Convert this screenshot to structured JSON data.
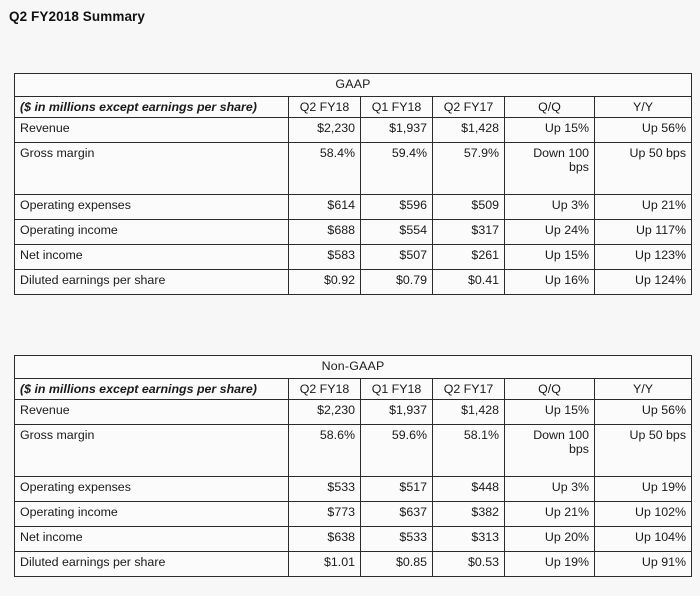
{
  "page": {
    "title": "Q2 FY2018 Summary",
    "background_color": "#f7f7f7",
    "text_color": "#1a1a1a",
    "border_color": "#2b2b2b"
  },
  "tables": [
    {
      "section_title": "GAAP",
      "label_header": "($ in millions except earnings per share)",
      "columns": [
        "Q2 FY18",
        "Q1 FY18",
        "Q2 FY17",
        "Q/Q",
        "Y/Y"
      ],
      "rows": [
        {
          "label": "Revenue",
          "values": [
            "$2,230",
            "$1,937",
            "$1,428",
            "Up 15%",
            "Up 56%"
          ]
        },
        {
          "label": "Gross margin",
          "values": [
            "58.4%",
            "59.4%",
            "57.9%",
            "Down 100 bps",
            "Up 50 bps"
          ]
        },
        {
          "label": "Operating expenses",
          "values": [
            "$614",
            "$596",
            "$509",
            "Up 3%",
            "Up 21%"
          ]
        },
        {
          "label": "Operating income",
          "values": [
            "$688",
            "$554",
            "$317",
            "Up 24%",
            "Up 117%"
          ]
        },
        {
          "label": "Net income",
          "values": [
            "$583",
            "$507",
            "$261",
            "Up 15%",
            "Up 123%"
          ]
        },
        {
          "label": "Diluted earnings per share",
          "values": [
            "$0.92",
            "$0.79",
            "$0.41",
            "Up 16%",
            "Up 124%"
          ]
        }
      ]
    },
    {
      "section_title": "Non-GAAP",
      "label_header": "($ in millions except earnings per share)",
      "columns": [
        "Q2 FY18",
        "Q1 FY18",
        "Q2 FY17",
        "Q/Q",
        "Y/Y"
      ],
      "rows": [
        {
          "label": "Revenue",
          "values": [
            "$2,230",
            "$1,937",
            "$1,428",
            "Up 15%",
            "Up 56%"
          ]
        },
        {
          "label": "Gross margin",
          "values": [
            "58.6%",
            "59.6%",
            "58.1%",
            "Down 100 bps",
            "Up 50 bps"
          ]
        },
        {
          "label": "Operating expenses",
          "values": [
            "$533",
            "$517",
            "$448",
            "Up 3%",
            "Up 19%"
          ]
        },
        {
          "label": "Operating income",
          "values": [
            "$773",
            "$637",
            "$382",
            "Up 21%",
            "Up 102%"
          ]
        },
        {
          "label": "Net income",
          "values": [
            "$638",
            "$533",
            "$313",
            "Up 20%",
            "Up 104%"
          ]
        },
        {
          "label": "Diluted earnings per share",
          "values": [
            "$1.01",
            "$0.85",
            "$0.53",
            "Up 19%",
            "Up 91%"
          ]
        }
      ]
    }
  ]
}
